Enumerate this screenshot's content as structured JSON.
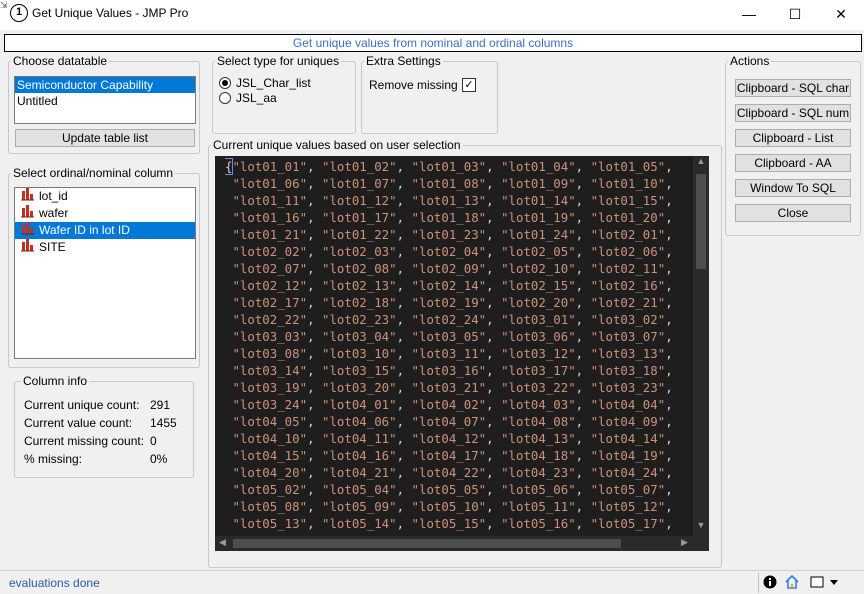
{
  "window": {
    "title": "Get Unique Values - JMP Pro",
    "app_icon_glyph": "1",
    "controls": {
      "minimize": "—",
      "maximize": "☐",
      "close": "✕"
    }
  },
  "banner": {
    "text": "Get unique values from nominal and ordinal columns",
    "color": "#3a6fc4"
  },
  "choose_datatable": {
    "legend": "Choose datatable",
    "items": [
      "Semiconductor Capability",
      "Untitled"
    ],
    "selected_index": 0,
    "update_button": "Update table list"
  },
  "select_column": {
    "legend": "Select ordinal/nominal column",
    "items": [
      {
        "label": "lot_id",
        "icon": "nominal-bar-icon"
      },
      {
        "label": "wafer",
        "icon": "nominal-bar-icon"
      },
      {
        "label": "Wafer ID in lot ID",
        "icon": "nominal-bar-icon"
      },
      {
        "label": "SITE",
        "icon": "nominal-bar-icon"
      }
    ],
    "selected_index": 2
  },
  "column_info": {
    "legend": "Column info",
    "rows": [
      {
        "label": "Current unique count:",
        "value": "291"
      },
      {
        "label": "Current value count:",
        "value": "1455"
      },
      {
        "label": "Current missing count:",
        "value": "0"
      },
      {
        "label": "% missing:",
        "value": "0%"
      }
    ]
  },
  "type_for_uniques": {
    "legend": "Select type for uniques",
    "options": [
      "JSL_Char_list",
      "JSL_aa"
    ],
    "selected_index": 0
  },
  "extra_settings": {
    "legend": "Extra Settings",
    "remove_missing_label": "Remove missing",
    "remove_missing_checked": true
  },
  "unique_values": {
    "legend": "Current unique values based on user selection",
    "open_brace": "{",
    "lines": [
      [
        "lot01_01",
        "lot01_02",
        "lot01_03",
        "lot01_04",
        "lot01_05"
      ],
      [
        "lot01_06",
        "lot01_07",
        "lot01_08",
        "lot01_09",
        "lot01_10"
      ],
      [
        "lot01_11",
        "lot01_12",
        "lot01_13",
        "lot01_14",
        "lot01_15"
      ],
      [
        "lot01_16",
        "lot01_17",
        "lot01_18",
        "lot01_19",
        "lot01_20"
      ],
      [
        "lot01_21",
        "lot01_22",
        "lot01_23",
        "lot01_24",
        "lot02_01"
      ],
      [
        "lot02_02",
        "lot02_03",
        "lot02_04",
        "lot02_05",
        "lot02_06"
      ],
      [
        "lot02_07",
        "lot02_08",
        "lot02_09",
        "lot02_10",
        "lot02_11"
      ],
      [
        "lot02_12",
        "lot02_13",
        "lot02_14",
        "lot02_15",
        "lot02_16"
      ],
      [
        "lot02_17",
        "lot02_18",
        "lot02_19",
        "lot02_20",
        "lot02_21"
      ],
      [
        "lot02_22",
        "lot02_23",
        "lot02_24",
        "lot03_01",
        "lot03_02"
      ],
      [
        "lot03_03",
        "lot03_04",
        "lot03_05",
        "lot03_06",
        "lot03_07"
      ],
      [
        "lot03_08",
        "lot03_10",
        "lot03_11",
        "lot03_12",
        "lot03_13"
      ],
      [
        "lot03_14",
        "lot03_15",
        "lot03_16",
        "lot03_17",
        "lot03_18"
      ],
      [
        "lot03_19",
        "lot03_20",
        "lot03_21",
        "lot03_22",
        "lot03_23"
      ],
      [
        "lot03_24",
        "lot04_01",
        "lot04_02",
        "lot04_03",
        "lot04_04"
      ],
      [
        "lot04_05",
        "lot04_06",
        "lot04_07",
        "lot04_08",
        "lot04_09"
      ],
      [
        "lot04_10",
        "lot04_11",
        "lot04_12",
        "lot04_13",
        "lot04_14"
      ],
      [
        "lot04_15",
        "lot04_16",
        "lot04_17",
        "lot04_18",
        "lot04_19"
      ],
      [
        "lot04_20",
        "lot04_21",
        "lot04_22",
        "lot04_23",
        "lot04_24"
      ],
      [
        "lot05_02",
        "lot05_04",
        "lot05_05",
        "lot05_06",
        "lot05_07"
      ],
      [
        "lot05_08",
        "lot05_09",
        "lot05_10",
        "lot05_11",
        "lot05_12"
      ],
      [
        "lot05_13",
        "lot05_14",
        "lot05_15",
        "lot05_16",
        "lot05_17"
      ]
    ],
    "string_color": "#ce9178",
    "background": "#1e1e1e"
  },
  "actions": {
    "legend": "Actions",
    "buttons": [
      "Clipboard - SQL char",
      "Clipboard - SQL num",
      "Clipboard - List",
      "Clipboard - AA",
      "Window To SQL",
      "Close"
    ]
  },
  "status_bar": {
    "text": "evaluations done",
    "icons": [
      "info-icon",
      "home-icon",
      "window-icon",
      "dropdown-arrow-icon"
    ]
  }
}
